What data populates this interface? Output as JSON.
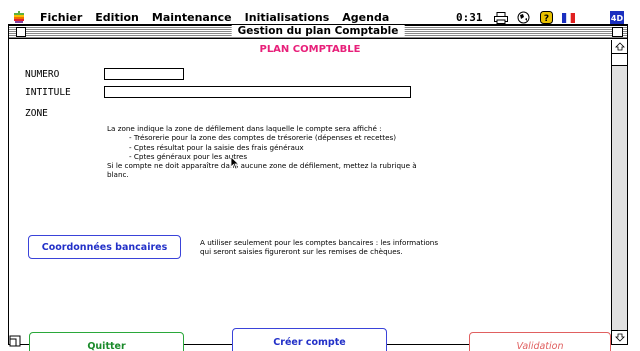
{
  "menubar": {
    "items": [
      "Fichier",
      "Edition",
      "Maintenance",
      "Initialisations",
      "Agenda"
    ],
    "clock": "0:31",
    "icons": [
      "apple-icon",
      "printer-icon",
      "globe-icon",
      "help-icon",
      "flag-icon",
      "4d-icon"
    ]
  },
  "window": {
    "title": "Gestion du plan Comptable"
  },
  "form": {
    "heading": "PLAN COMPTABLE",
    "numero_label": "NUMERO",
    "numero_value": "",
    "intitule_label": "INTITULE",
    "intitule_value": "",
    "zone_label": "ZONE",
    "zone_help": [
      "La zone indique la zone de défilement dans laquelle le compte sera affiché :",
      "- Trésorerie pour la zone des comptes de trésorerie (dépenses et recettes)",
      "- Cptes résultat pour la saisie des frais généraux",
      "- Cptes généraux pour les autres",
      "Si le compte ne doit apparaître dans aucune zone de défilement, mettez la rubrique à",
      "blanc."
    ],
    "bank_button": "Coordonnées bancaires",
    "bank_note": [
      "A utiliser seulement pour les comptes bancaires : les informations",
      "qui seront saisies figureront sur les remises de chèques."
    ]
  },
  "buttons": {
    "quit": "Quitter",
    "create": "Créer compte",
    "validate": "Validation"
  },
  "colors": {
    "heading": "#e8207a",
    "blue_button": "#2230c8",
    "green_button": "#1a8a2a",
    "red_button": "#e06060"
  }
}
